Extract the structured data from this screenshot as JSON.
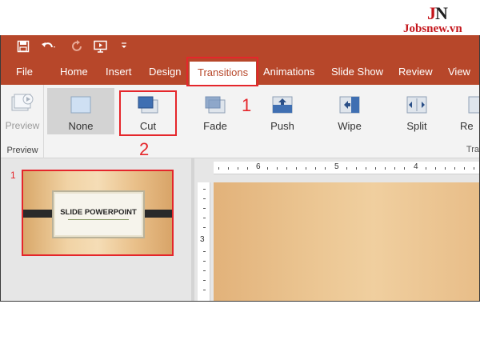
{
  "watermark": {
    "logo_j": "J",
    "logo_n": "N",
    "site": "Jobsnew.vn"
  },
  "qat": {
    "icons": [
      "save-icon",
      "undo-icon",
      "redo-icon",
      "start-from-beginning-icon",
      "customize-dropdown-icon"
    ]
  },
  "tabs": [
    {
      "label": "File"
    },
    {
      "label": "Home"
    },
    {
      "label": "Insert"
    },
    {
      "label": "Design"
    },
    {
      "label": "Transitions",
      "active": true
    },
    {
      "label": "Animations"
    },
    {
      "label": "Slide Show"
    },
    {
      "label": "Review"
    },
    {
      "label": "View"
    }
  ],
  "ribbon": {
    "preview_label": "Preview",
    "preview_group_label": "Preview",
    "transitions_group_label": "Tra",
    "transitions": [
      {
        "label": "None",
        "icon": "none-transition-icon",
        "selected": true
      },
      {
        "label": "Cut",
        "icon": "cut-transition-icon"
      },
      {
        "label": "Fade",
        "icon": "fade-transition-icon"
      },
      {
        "label": "Push",
        "icon": "push-transition-icon"
      },
      {
        "label": "Wipe",
        "icon": "wipe-transition-icon"
      },
      {
        "label": "Split",
        "icon": "split-transition-icon"
      },
      {
        "label": "Re",
        "icon": "reveal-transition-icon"
      }
    ]
  },
  "annotations": {
    "step1": "1",
    "step2": "2",
    "color": "#e5262b"
  },
  "slides_pane": {
    "slide_number": "1",
    "slide_title": "SLIDE POWERPOINT"
  },
  "ruler": {
    "h_labels": [
      "6",
      "5",
      "4"
    ],
    "v_labels": [
      "3"
    ]
  },
  "colors": {
    "accent": "#b7472a",
    "selected_item": "#d3d3d3"
  }
}
